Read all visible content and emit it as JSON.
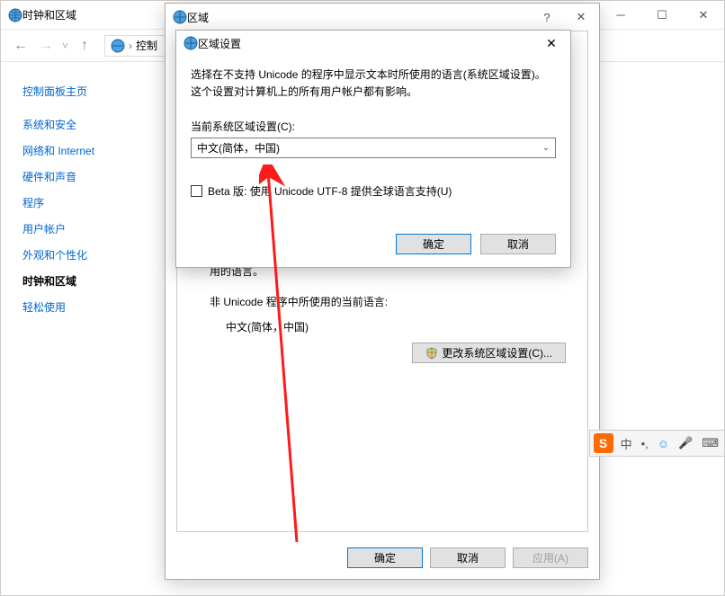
{
  "parent": {
    "title": "时钟和区域",
    "breadcrumb_part": "控制",
    "sidebar_home": "控制面板主页",
    "sidebar": [
      {
        "label": "系统和安全",
        "active": false
      },
      {
        "label": "网络和 Internet",
        "active": false
      },
      {
        "label": "硬件和声音",
        "active": false
      },
      {
        "label": "程序",
        "active": false
      },
      {
        "label": "用户帐户",
        "active": false
      },
      {
        "label": "外观和个性化",
        "active": false
      },
      {
        "label": "时钟和区域",
        "active": true
      },
      {
        "label": "轻松使用",
        "active": false
      }
    ]
  },
  "region_dialog": {
    "title": "区域",
    "used_lang_label": "用的语言。",
    "non_unicode_label": "非 Unicode 程序中所使用的当前语言:",
    "current_lang": "中文(简体，中国)",
    "change_btn": "更改系统区域设置(C)...",
    "ok": "确定",
    "cancel": "取消",
    "apply": "应用(A)"
  },
  "settings_dialog": {
    "title": "区域设置",
    "description": "选择在不支持 Unicode 的程序中显示文本时所使用的语言(系统区域设置)。这个设置对计算机上的所有用户帐户都有影响。",
    "locale_label": "当前系统区域设置(C):",
    "locale_value": "中文(简体，中国)",
    "beta_checkbox": "Beta 版: 使用 Unicode UTF-8 提供全球语言支持(U)",
    "ok": "确定",
    "cancel": "取消"
  },
  "ime": {
    "mode": "中"
  }
}
